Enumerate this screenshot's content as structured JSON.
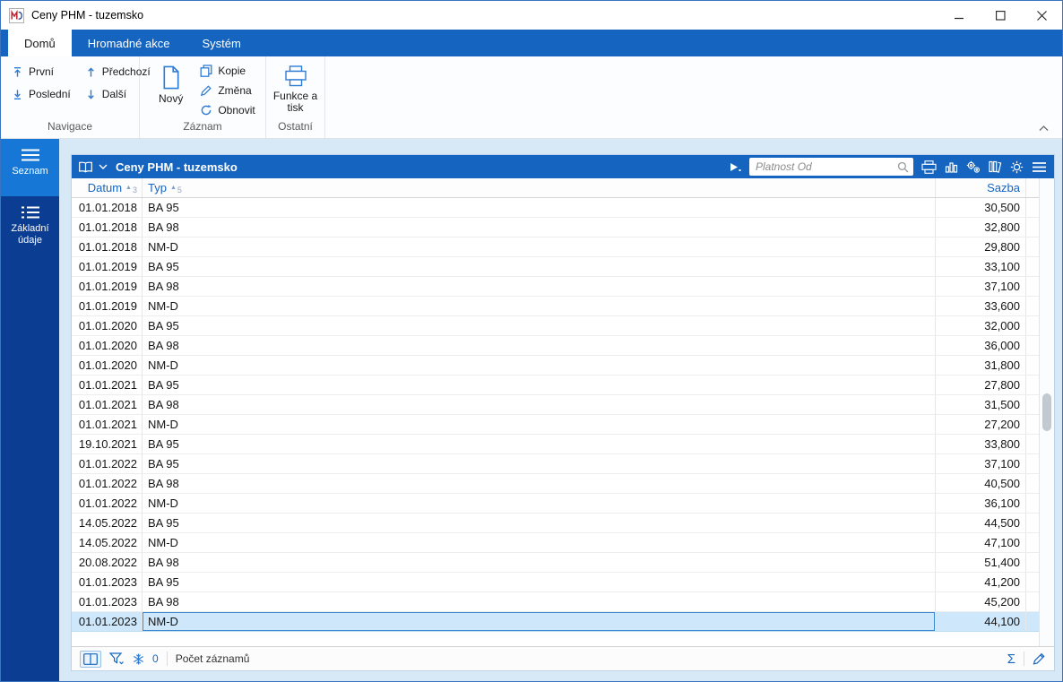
{
  "window": {
    "title": "Ceny PHM - tuzemsko"
  },
  "ribbon": {
    "tabs": [
      {
        "label": "Domů"
      },
      {
        "label": "Hromadné akce"
      },
      {
        "label": "Systém"
      }
    ],
    "navigace": {
      "label": "Navigace",
      "first": "První",
      "last": "Poslední",
      "previous": "Předchozí",
      "next": "Další"
    },
    "zaznam": {
      "label": "Záznam",
      "new": "Nový",
      "copy": "Kopie",
      "change": "Změna",
      "refresh": "Obnovit"
    },
    "ostatni": {
      "label": "Ostatní",
      "functions_print": "Funkce a tisk"
    }
  },
  "sidebar": {
    "items": [
      {
        "label": "Seznam",
        "active": true
      },
      {
        "label": "Základní údaje",
        "active": false
      }
    ]
  },
  "panel": {
    "title": "Ceny PHM - tuzemsko",
    "search_placeholder": "Platnost Od"
  },
  "table": {
    "columns": [
      {
        "label": "Datum",
        "sort_marker": "▲",
        "sort_index": "3"
      },
      {
        "label": "Typ",
        "sort_marker": "▲",
        "sort_index": "5"
      },
      {
        "label": "Sazba"
      }
    ],
    "selected_index": 21,
    "rows": [
      {
        "datum": "01.01.2018",
        "typ": "BA 95",
        "sazba": "30,500"
      },
      {
        "datum": "01.01.2018",
        "typ": "BA 98",
        "sazba": "32,800"
      },
      {
        "datum": "01.01.2018",
        "typ": "NM-D",
        "sazba": "29,800"
      },
      {
        "datum": "01.01.2019",
        "typ": "BA 95",
        "sazba": "33,100"
      },
      {
        "datum": "01.01.2019",
        "typ": "BA 98",
        "sazba": "37,100"
      },
      {
        "datum": "01.01.2019",
        "typ": "NM-D",
        "sazba": "33,600"
      },
      {
        "datum": "01.01.2020",
        "typ": "BA 95",
        "sazba": "32,000"
      },
      {
        "datum": "01.01.2020",
        "typ": "BA 98",
        "sazba": "36,000"
      },
      {
        "datum": "01.01.2020",
        "typ": "NM-D",
        "sazba": "31,800"
      },
      {
        "datum": "01.01.2021",
        "typ": "BA 95",
        "sazba": "27,800"
      },
      {
        "datum": "01.01.2021",
        "typ": "BA 98",
        "sazba": "31,500"
      },
      {
        "datum": "01.01.2021",
        "typ": "NM-D",
        "sazba": "27,200"
      },
      {
        "datum": "19.10.2021",
        "typ": "BA 95",
        "sazba": "33,800"
      },
      {
        "datum": "01.01.2022",
        "typ": "BA 95",
        "sazba": "37,100"
      },
      {
        "datum": "01.01.2022",
        "typ": "BA 98",
        "sazba": "40,500"
      },
      {
        "datum": "01.01.2022",
        "typ": "NM-D",
        "sazba": "36,100"
      },
      {
        "datum": "14.05.2022",
        "typ": "BA 95",
        "sazba": "44,500"
      },
      {
        "datum": "14.05.2022",
        "typ": "NM-D",
        "sazba": "47,100"
      },
      {
        "datum": "20.08.2022",
        "typ": "BA 98",
        "sazba": "51,400"
      },
      {
        "datum": "01.01.2023",
        "typ": "BA 95",
        "sazba": "41,200"
      },
      {
        "datum": "01.01.2023",
        "typ": "BA 98",
        "sazba": "45,200"
      },
      {
        "datum": "01.01.2023",
        "typ": "NM-D",
        "sazba": "44,100"
      }
    ]
  },
  "statusbar": {
    "frozen_count": "0",
    "count_label": "Počet záznamů"
  },
  "colors": {
    "accent_blue": "#1565c0",
    "sidebar_dark": "#0b3e92",
    "sidebar_active": "#1677d6",
    "content_bg": "#d7e8f7",
    "selected_row": "#cfe7fa"
  }
}
